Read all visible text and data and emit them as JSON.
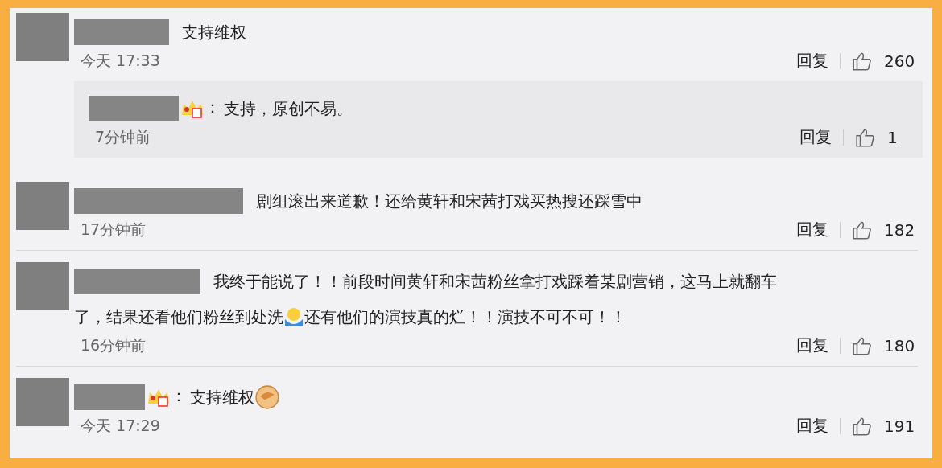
{
  "comments": [
    {
      "segments": [
        {
          "kind": "text",
          "text": "支持维权"
        }
      ],
      "time": "今天 17:33",
      "reply_label": "回复",
      "likes": "260",
      "replies": [
        {
          "badge": true,
          "separator": "：",
          "segments": [
            {
              "kind": "text",
              "text": "支持，原创不易。"
            }
          ],
          "time": "7分钟前",
          "reply_label": "回复",
          "likes": "1"
        }
      ]
    },
    {
      "segments": [
        {
          "kind": "text",
          "text": "剧组滚出来道歉！还给黄轩和宋茜打戏买热搜还踩雪中"
        }
      ],
      "time": "17分钟前",
      "reply_label": "回复",
      "likes": "182"
    },
    {
      "segments": [
        {
          "kind": "text",
          "text": "我终于能说了！！前段时间黄轩和宋茜粉丝拿打戏踩着某剧营销，这马上就翻车"
        },
        {
          "kind": "text",
          "text": "了，结果还看他们粉丝到处洗"
        },
        {
          "kind": "emoji"
        },
        {
          "kind": "text",
          "text": "还有他们的演技真的烂！！演技不可不可！！"
        }
      ],
      "time": "16分钟前",
      "reply_label": "回复",
      "likes": "180"
    },
    {
      "badge": true,
      "separator": "：",
      "segments": [
        {
          "kind": "text",
          "text": "支持维权"
        },
        {
          "kind": "fist"
        }
      ],
      "time": "今天 17:29",
      "reply_label": "回复",
      "likes": "191"
    }
  ]
}
